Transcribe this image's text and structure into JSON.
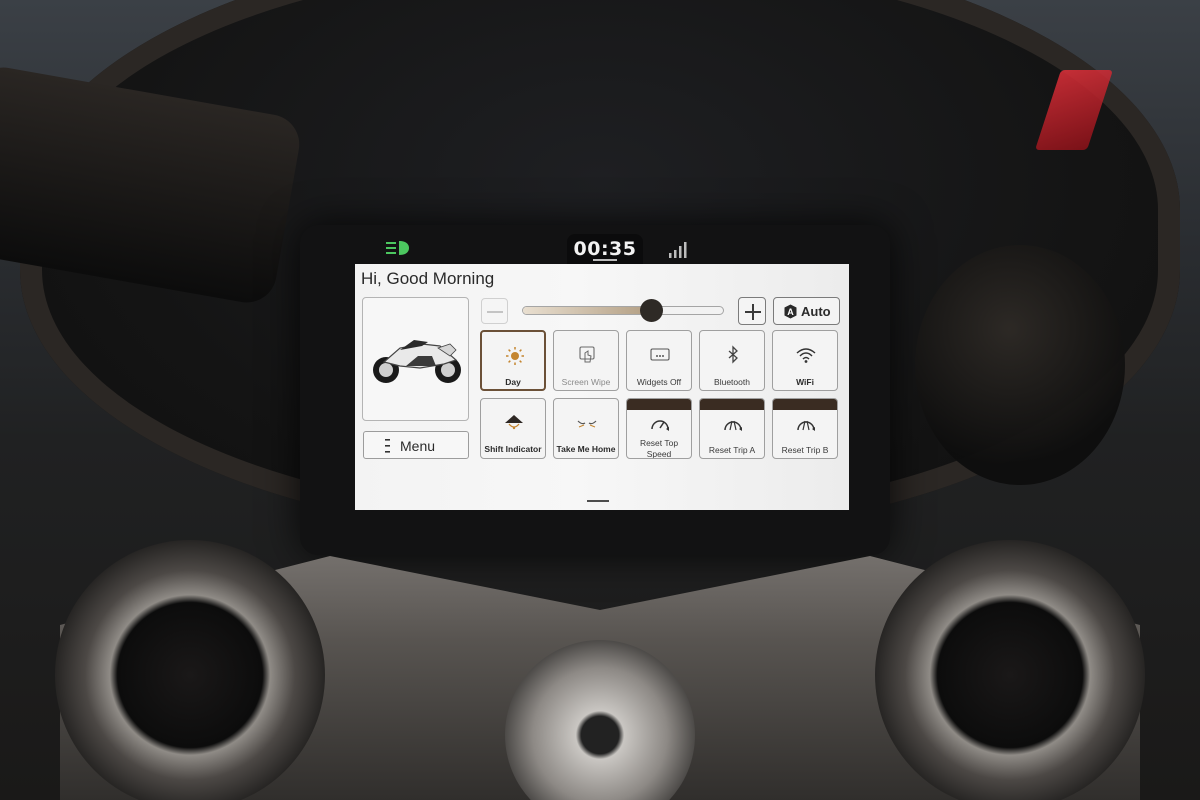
{
  "status_bar": {
    "time": "00:35",
    "headlight_icon": "headlight-icon",
    "signal_icon": "signal-bars-icon",
    "headlight_color": "#4cc760"
  },
  "dashboard": {
    "greeting": "Hi, Good Morning",
    "menu": {
      "label": "Menu",
      "icon": "menu-icon"
    },
    "brightness": {
      "level_percent": 64,
      "auto_label": "Auto",
      "auto_badge": "A"
    },
    "tiles_row1": [
      {
        "label": "Day",
        "icon": "sun-icon",
        "selected": true,
        "style": "dark"
      },
      {
        "label": "Screen Wipe",
        "icon": "hand-swipe-icon",
        "style": "dim"
      },
      {
        "label": "Widgets Off",
        "icon": "widgets-icon",
        "style": "mid"
      },
      {
        "label": "Bluetooth",
        "icon": "bluetooth-icon",
        "style": "mid"
      },
      {
        "label": "WiFi",
        "icon": "wifi-icon",
        "style": "dark"
      }
    ],
    "tiles_row2": [
      {
        "label": "Shift Indicator",
        "icon": "shift-indicator-icon",
        "style": "dark"
      },
      {
        "label": "Take Me Home",
        "icon": "take-me-home-icon",
        "style": "dark"
      },
      {
        "label": "Reset Top Speed",
        "label_line1": "Reset Top",
        "label_line2": "Speed",
        "icon": "speedometer-reset-icon",
        "style": "mid"
      },
      {
        "label": "Reset Trip A",
        "icon": "trip-reset-icon",
        "style": "mid"
      },
      {
        "label": "Reset Trip B",
        "icon": "trip-reset-icon",
        "style": "mid"
      }
    ],
    "accent_color": "#6b5037"
  }
}
